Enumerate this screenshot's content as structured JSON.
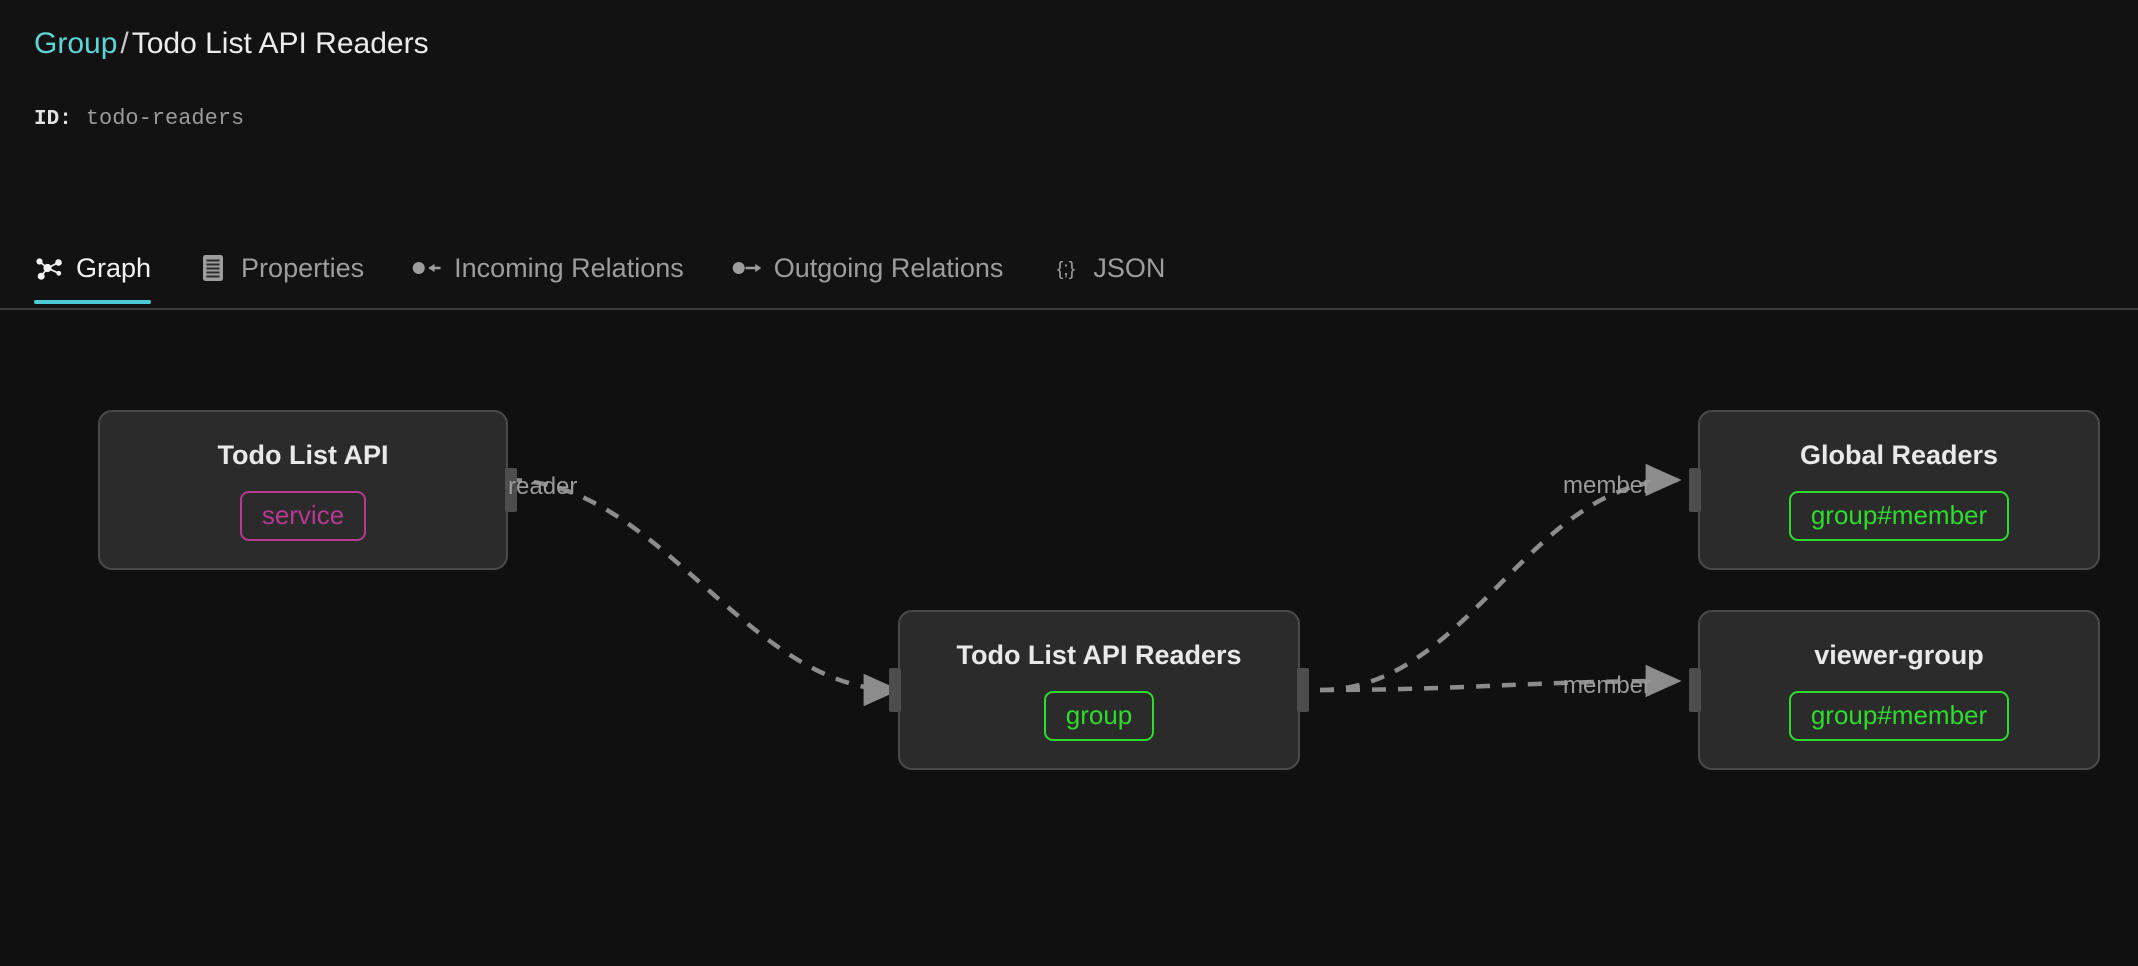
{
  "header": {
    "breadcrumb": {
      "parent": "Group",
      "separator": "/",
      "current": "Todo List API Readers"
    },
    "id_label": "ID:",
    "id_value": "todo-readers"
  },
  "tabs": [
    {
      "label": "Graph",
      "icon": "graph-icon",
      "active": true
    },
    {
      "label": "Properties",
      "icon": "document-icon",
      "active": false
    },
    {
      "label": "Incoming Relations",
      "icon": "arrow-in-icon",
      "active": false
    },
    {
      "label": "Outgoing Relations",
      "icon": "arrow-out-icon",
      "active": false
    },
    {
      "label": "JSON",
      "icon": "braces-icon",
      "active": false
    }
  ],
  "graph": {
    "nodes": [
      {
        "id": "todo-list-api",
        "title": "Todo List API",
        "badge": "service",
        "badge_kind": "service"
      },
      {
        "id": "todo-list-api-readers",
        "title": "Todo List API Readers",
        "badge": "group",
        "badge_kind": "group"
      },
      {
        "id": "global-readers",
        "title": "Global Readers",
        "badge": "group#member",
        "badge_kind": "group"
      },
      {
        "id": "viewer-group",
        "title": "viewer-group",
        "badge": "group#member",
        "badge_kind": "group"
      }
    ],
    "edges": [
      {
        "source": "todo-list-api",
        "target": "todo-list-api-readers",
        "label": "reader"
      },
      {
        "source": "todo-list-api-readers",
        "target": "global-readers",
        "label": "member"
      },
      {
        "source": "todo-list-api-readers",
        "target": "viewer-group",
        "label": "member"
      }
    ]
  },
  "colors": {
    "accent_teal": "#4dcbd4",
    "link_teal": "#5fd4d6",
    "badge_service": "#b43a93",
    "badge_group": "#2fdb2f",
    "edge_stroke": "#8c8c8c",
    "canvas_bg": "#101010",
    "node_bg": "#2b2b2b"
  }
}
